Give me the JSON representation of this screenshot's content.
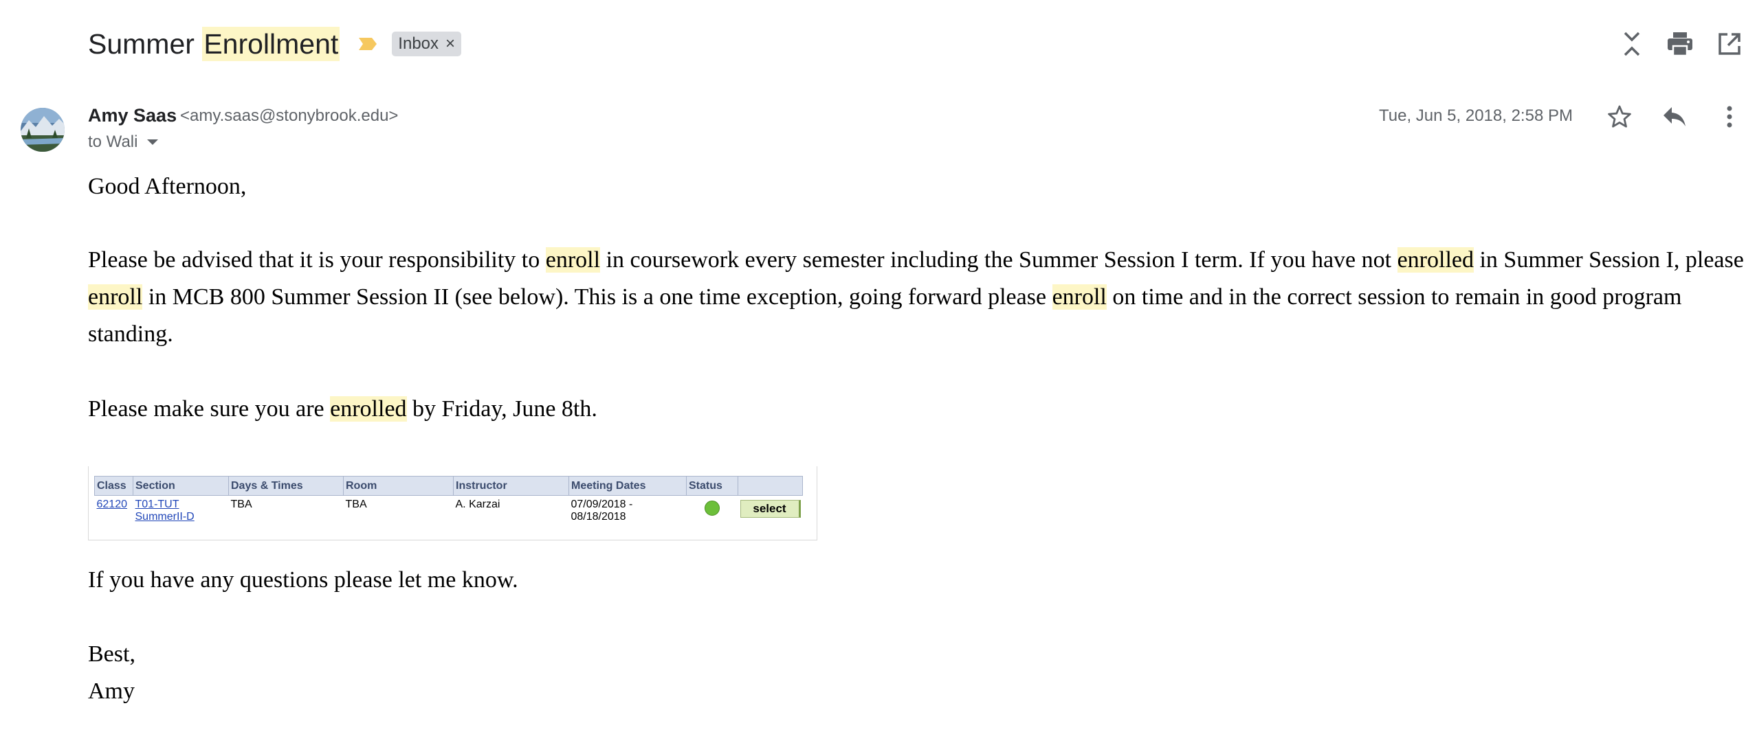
{
  "header": {
    "subject_pre": "Summer ",
    "subject_hl": "Enrollment",
    "label": "Inbox",
    "label_remove": "×"
  },
  "message": {
    "sender_name": "Amy Saas",
    "sender_email": "<amy.saas@stonybrook.edu>",
    "recipients": "to Wali",
    "timestamp": "Tue, Jun 5, 2018, 2:58 PM"
  },
  "body": {
    "greeting": "Good Afternoon,",
    "p1": [
      {
        "t": "Please be advised that it is your responsibility to "
      },
      {
        "t": "enroll",
        "hl": true
      },
      {
        "t": " in coursework every semester including the Summer Session I term.  If you have not "
      },
      {
        "t": "enrolled",
        "hl": true
      },
      {
        "t": " in Summer Session I, please "
      },
      {
        "t": "enroll",
        "hl": true
      },
      {
        "t": " in MCB 800 Summer Session II (see below). This is a one time exception, going forward please "
      },
      {
        "t": "enroll",
        "hl": true
      },
      {
        "t": " on time and in the correct session to remain in good program standing."
      }
    ],
    "p2_pre": "Please make sure you are ",
    "p2_hl": "enrolled",
    "p2_post": " by Friday, June 8th.",
    "questions": "If you have any questions please let me know.",
    "signoff": "Best,",
    "signature": "Amy"
  },
  "class_table": {
    "headers": [
      "Class",
      "Section",
      "Days & Times",
      "Room",
      "Instructor",
      "Meeting Dates",
      "Status",
      ""
    ],
    "row": {
      "class": "62120",
      "section_line1": "T01-TUT",
      "section_line2": "SummerII-D",
      "days_times": "TBA",
      "room": "TBA",
      "instructor": "A. Karzai",
      "dates_line1": "07/09/2018 -",
      "dates_line2": "08/18/2018",
      "action": "select"
    }
  },
  "colors": {
    "highlight": "#fdf6c6",
    "status_open": "#6cbf3a",
    "link": "#2046b8"
  }
}
